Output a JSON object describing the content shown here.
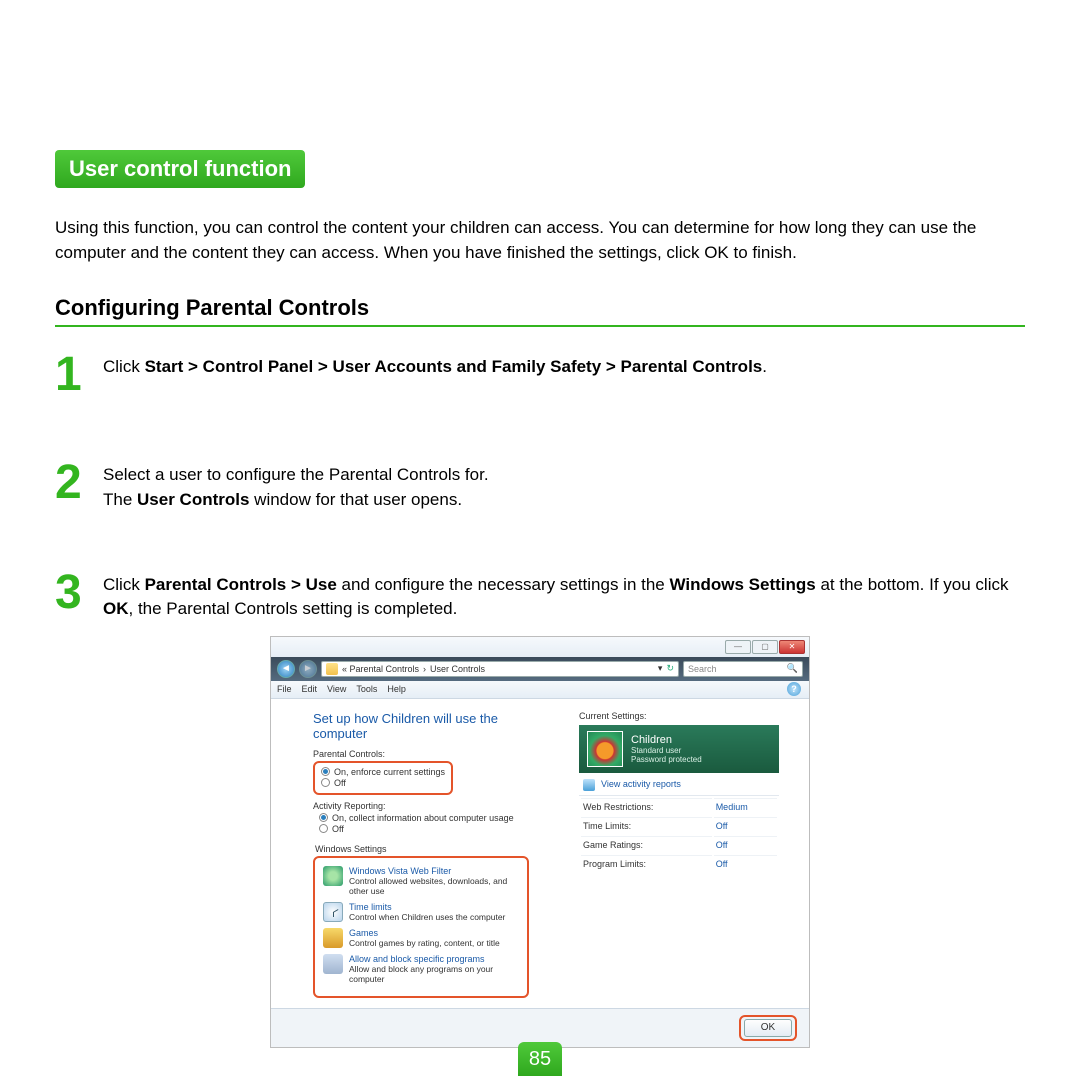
{
  "header": {
    "pill": "User control function"
  },
  "intro": "Using this function, you can control the content your children can access. You can determine for how long they can use the computer and the content they can access. When you have finished the settings, click OK to finish.",
  "section_title": "Configuring Parental Controls",
  "steps": {
    "s1": {
      "num": "1",
      "pre": "Click ",
      "bold": "Start > Control Panel > User Accounts and Family Safety > Parental Controls",
      "post": "."
    },
    "s2": {
      "num": "2",
      "l1": "Select a user to configure the Parental Controls for.",
      "l2a": "The ",
      "l2b": "User Controls",
      "l2c": " window for that user opens."
    },
    "s3": {
      "num": "3",
      "a": "Click ",
      "b": "Parental Controls > Use",
      "c": " and configure the necessary settings in the ",
      "d": "Windows Settings",
      "e": " at the bottom. If you click ",
      "f": "OK",
      "g": ", the Parental Controls setting is completed."
    }
  },
  "ss": {
    "breadcrumb": {
      "a": "«  Parental Controls",
      "b": "User Controls",
      "sep": "›"
    },
    "search_ph": "Search",
    "menu": [
      "File",
      "Edit",
      "View",
      "Tools",
      "Help"
    ],
    "title": "Set up how Children will use the computer",
    "pc_label": "Parental Controls:",
    "pc_on": "On, enforce current settings",
    "pc_off": "Off",
    "ar_label": "Activity Reporting:",
    "ar_on": "On, collect information about computer usage",
    "ar_off": "Off",
    "ws_label": "Windows Settings",
    "ws": [
      {
        "t": "Windows Vista Web Filter",
        "d": "Control allowed websites, downloads, and other use"
      },
      {
        "t": "Time limits",
        "d": "Control when Children uses the computer"
      },
      {
        "t": "Games",
        "d": "Control games by rating, content, or title"
      },
      {
        "t": "Allow and block specific programs",
        "d": "Allow and block any programs on your computer"
      }
    ],
    "cs_label": "Current Settings:",
    "user": {
      "name": "Children",
      "type": "Standard user",
      "pw": "Password protected"
    },
    "view_link": "View activity reports",
    "rows": [
      {
        "k": "Web Restrictions:",
        "v": "Medium"
      },
      {
        "k": "Time Limits:",
        "v": "Off"
      },
      {
        "k": "Game Ratings:",
        "v": "Off"
      },
      {
        "k": "Program Limits:",
        "v": "Off"
      }
    ],
    "ok": "OK"
  },
  "page_number": "85"
}
